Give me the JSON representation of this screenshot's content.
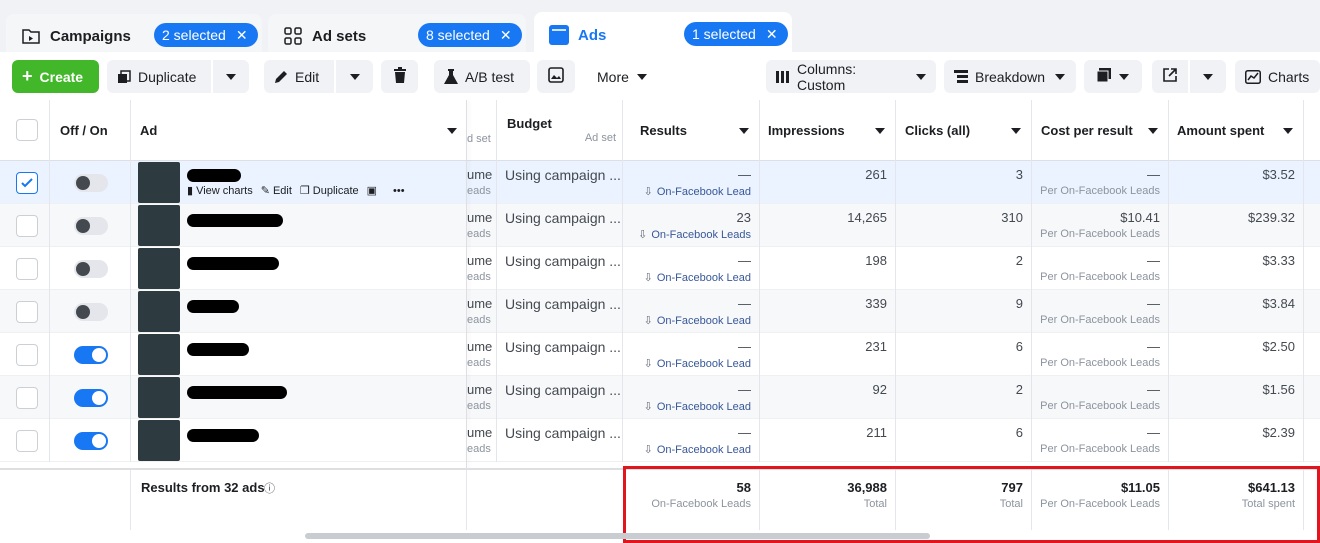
{
  "tabs": [
    {
      "label": "Campaigns",
      "icon": "folder-icon",
      "selected": "2 selected"
    },
    {
      "label": "Ad sets",
      "icon": "grid-icon",
      "selected": "8 selected"
    },
    {
      "label": "Ads",
      "icon": "ad-icon",
      "selected": "1 selected"
    }
  ],
  "toolbar": {
    "create": "Create",
    "duplicate": "Duplicate",
    "edit": "Edit",
    "ab_test": "A/B test",
    "more": "More",
    "columns": "Columns: Custom",
    "breakdown": "Breakdown",
    "charts": "Charts"
  },
  "columns": {
    "off_on": "Off / On",
    "ad": "Ad",
    "ad_set_clip": "d set",
    "budget": "Budget",
    "budget_sub": "Ad set",
    "results": "Results",
    "impressions": "Impressions",
    "clicks": "Clicks (all)",
    "cost_per_result": "Cost per result",
    "amount_spent": "Amount spent"
  },
  "row_actions": {
    "view_charts": "View charts",
    "edit": "Edit",
    "duplicate": "Duplicate"
  },
  "rows": [
    {
      "selected": true,
      "on": false,
      "clip1": "ume",
      "clip2": "eads",
      "budget": "Using campaign ...",
      "result": "—",
      "result_label": "On-Facebook Lead",
      "impressions": "261",
      "clicks": "3",
      "cpr": "—",
      "cpr_label": "Per On-Facebook Leads",
      "spent": "$3.52"
    },
    {
      "selected": false,
      "on": false,
      "clip1": "ume",
      "clip2": "eads",
      "budget": "Using campaign ...",
      "result": "23",
      "result_label": "On-Facebook Leads",
      "impressions": "14,265",
      "clicks": "310",
      "cpr": "$10.41",
      "cpr_label": "Per On-Facebook Leads",
      "spent": "$239.32"
    },
    {
      "selected": false,
      "on": false,
      "clip1": "ume",
      "clip2": "eads",
      "budget": "Using campaign ...",
      "result": "—",
      "result_label": "On-Facebook Lead",
      "impressions": "198",
      "clicks": "2",
      "cpr": "—",
      "cpr_label": "Per On-Facebook Leads",
      "spent": "$3.33"
    },
    {
      "selected": false,
      "on": false,
      "clip1": "ume",
      "clip2": "eads",
      "budget": "Using campaign ...",
      "result": "—",
      "result_label": "On-Facebook Lead",
      "impressions": "339",
      "clicks": "9",
      "cpr": "—",
      "cpr_label": "Per On-Facebook Leads",
      "spent": "$3.84"
    },
    {
      "selected": false,
      "on": true,
      "clip1": "ume",
      "clip2": "eads",
      "budget": "Using campaign ...",
      "result": "—",
      "result_label": "On-Facebook Lead",
      "impressions": "231",
      "clicks": "6",
      "cpr": "—",
      "cpr_label": "Per On-Facebook Leads",
      "spent": "$2.50"
    },
    {
      "selected": false,
      "on": true,
      "clip1": "ume",
      "clip2": "eads",
      "budget": "Using campaign ...",
      "result": "—",
      "result_label": "On-Facebook Lead",
      "impressions": "92",
      "clicks": "2",
      "cpr": "—",
      "cpr_label": "Per On-Facebook Leads",
      "spent": "$1.56"
    },
    {
      "selected": false,
      "on": true,
      "clip1": "ume",
      "clip2": "eads",
      "budget": "Using campaign ...",
      "result": "—",
      "result_label": "On-Facebook Lead",
      "impressions": "211",
      "clicks": "6",
      "cpr": "—",
      "cpr_label": "Per On-Facebook Leads",
      "spent": "$2.39"
    }
  ],
  "summary": {
    "label": "Results from 32 ads",
    "results": "58",
    "results_sub": "On-Facebook Leads",
    "impressions": "36,988",
    "impressions_sub": "Total",
    "clicks": "797",
    "clicks_sub": "Total",
    "cpr": "$11.05",
    "cpr_sub": "Per On-Facebook Leads",
    "spent": "$641.13",
    "spent_sub": "Total spent"
  },
  "colors": {
    "accent": "#1877f2",
    "create": "#42b72a",
    "highlight": "#e0151e",
    "link": "#385898"
  }
}
